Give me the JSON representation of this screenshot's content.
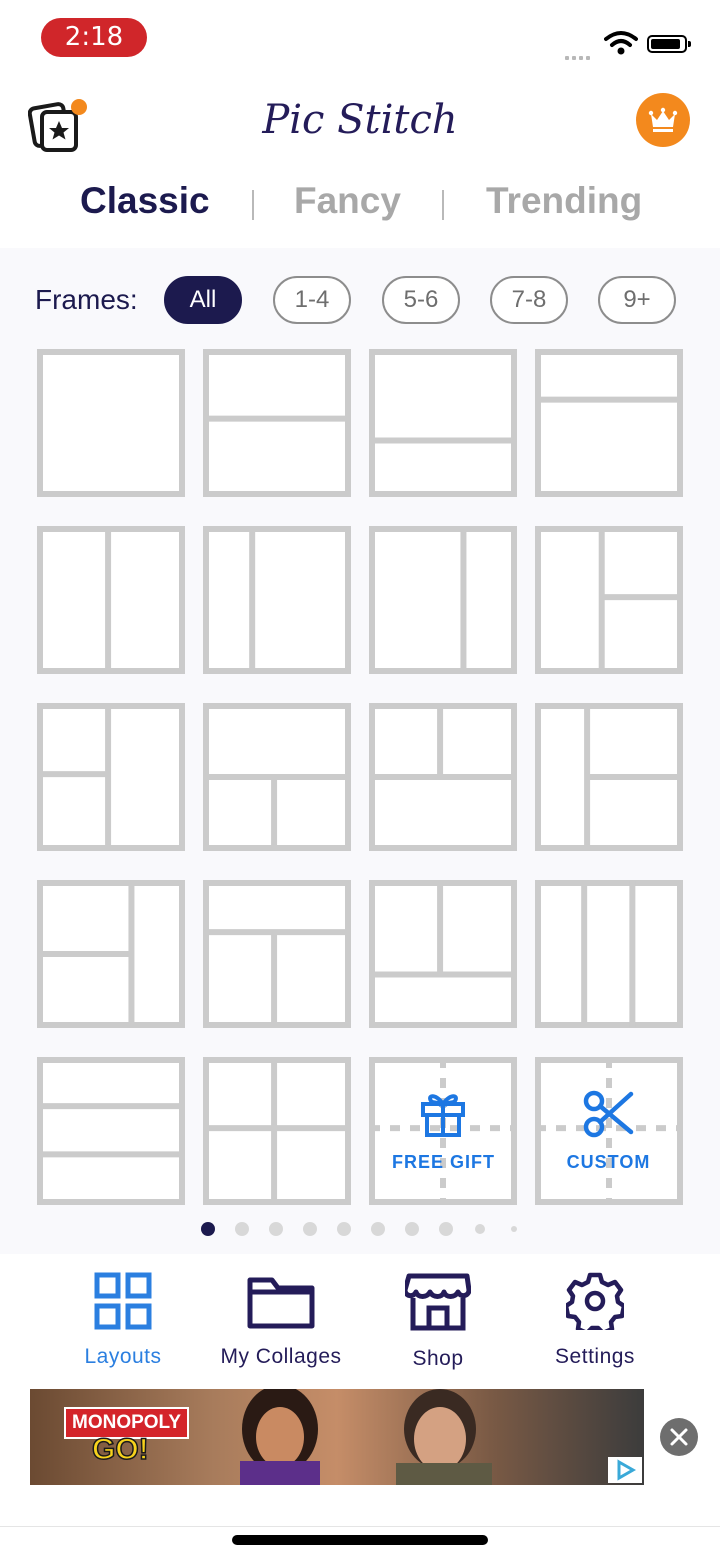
{
  "status_bar": {
    "time": "2:18"
  },
  "header": {
    "title": "Pic Stitch"
  },
  "tabs": [
    {
      "label": "Classic",
      "active": true
    },
    {
      "label": "Fancy",
      "active": false
    },
    {
      "label": "Trending",
      "active": false
    }
  ],
  "frames_filter": {
    "label": "Frames:",
    "chips": [
      {
        "label": "All",
        "active": true
      },
      {
        "label": "1-4",
        "active": false
      },
      {
        "label": "5-6",
        "active": false
      },
      {
        "label": "7-8",
        "active": false
      },
      {
        "label": "9+",
        "active": false
      }
    ]
  },
  "layout_grid": {
    "free_gift_label": "FREE GIFT",
    "custom_label": "CUSTOM"
  },
  "pagination": {
    "total": 10,
    "current": 1
  },
  "bottom_nav": [
    {
      "label": "Layouts",
      "icon": "grid-icon",
      "active": true
    },
    {
      "label": "My Collages",
      "icon": "folder-icon",
      "active": false
    },
    {
      "label": "Shop",
      "icon": "store-icon",
      "active": false
    },
    {
      "label": "Settings",
      "icon": "gear-icon",
      "active": false
    }
  ],
  "ad": {
    "brand_line1": "MONOPOLY",
    "brand_line2": "GO!"
  },
  "colors": {
    "navy": "#1c1a4e",
    "accent_blue": "#2b7fe0",
    "orange": "#f3891d",
    "time_red": "#d0262a"
  }
}
